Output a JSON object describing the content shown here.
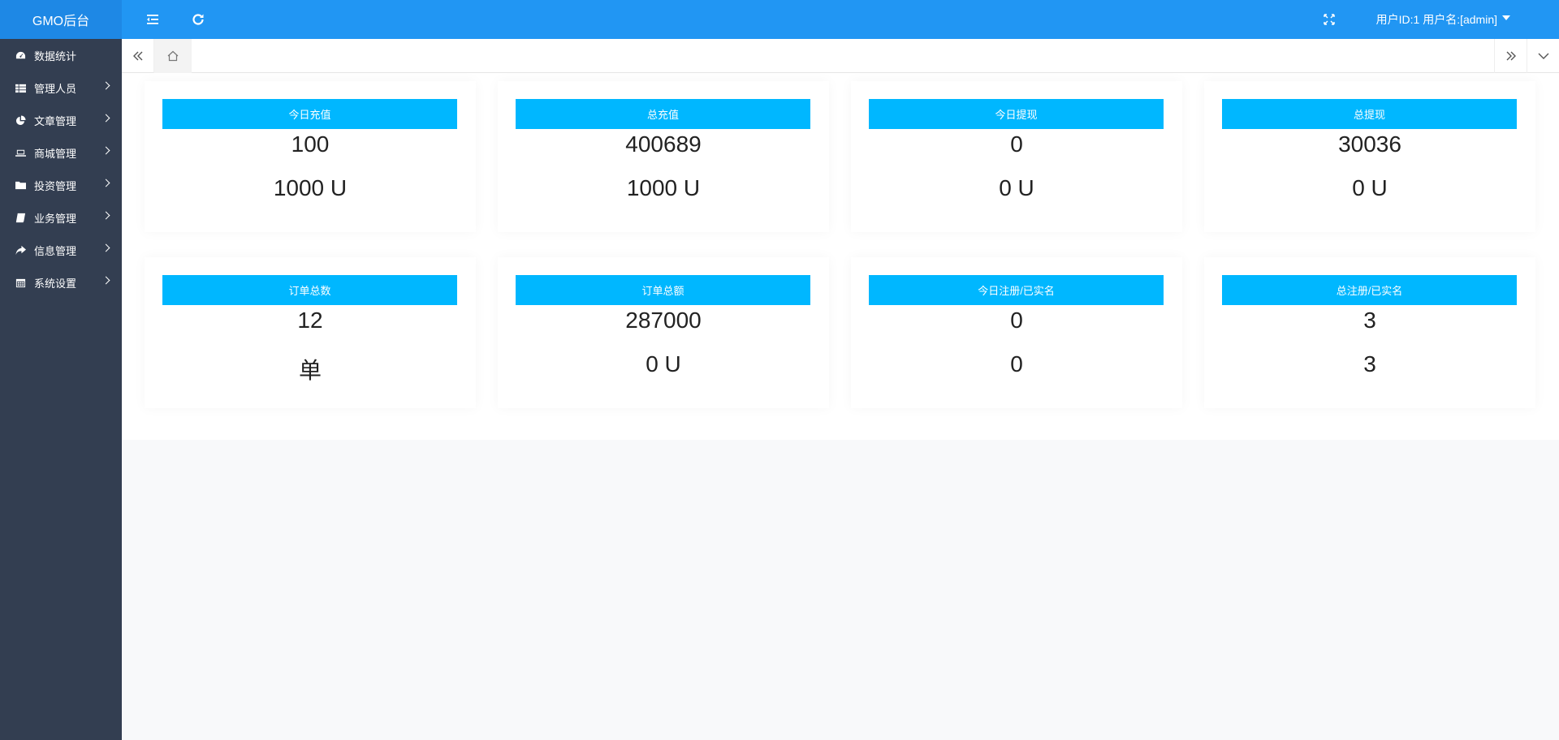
{
  "app": {
    "logo": "GMO后台"
  },
  "header": {
    "user_label": "用户ID:1 用户名:[admin]"
  },
  "sidebar": {
    "items": [
      {
        "label": "数据统计",
        "icon": "dashboard-icon"
      },
      {
        "label": "管理人员",
        "icon": "grid-icon"
      },
      {
        "label": "文章管理",
        "icon": "pie-chart-icon"
      },
      {
        "label": "商城管理",
        "icon": "laptop-icon"
      },
      {
        "label": "投资管理",
        "icon": "folder-icon"
      },
      {
        "label": "业务管理",
        "icon": "book-icon"
      },
      {
        "label": "信息管理",
        "icon": "share-icon"
      },
      {
        "label": "系统设置",
        "icon": "calendar-icon"
      }
    ]
  },
  "cards": [
    {
      "title": "今日充值",
      "value1": "100",
      "value2": "1000 U"
    },
    {
      "title": "总充值",
      "value1": "400689",
      "value2": "1000 U"
    },
    {
      "title": "今日提现",
      "value1": "0",
      "value2": "0 U"
    },
    {
      "title": "总提现",
      "value1": "30036",
      "value2": "0 U"
    },
    {
      "title": "订单总数",
      "value1": "12",
      "value2": "单"
    },
    {
      "title": "订单总额",
      "value1": "287000",
      "value2": "0 U"
    },
    {
      "title": "今日注册/已实名",
      "value1": "0",
      "value2": "0"
    },
    {
      "title": "总注册/已实名",
      "value1": "3",
      "value2": "3"
    }
  ],
  "colors": {
    "header": "#2196f3",
    "logo_bg": "#1e88e5",
    "sidebar": "#333e51",
    "card_head": "#00b7ff"
  }
}
